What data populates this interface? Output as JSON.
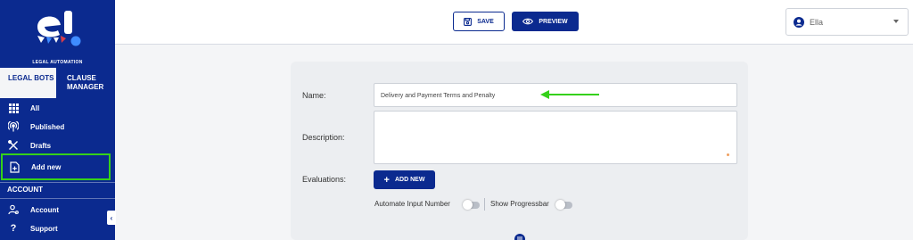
{
  "brand": {
    "caption": "LEGAL AUTOMATION",
    "logo_icon": "elegal-logo-icon",
    "accent_color": "#0b2a8f"
  },
  "sidebar": {
    "tabs": [
      {
        "label": "LEGAL BOTS",
        "active": true
      },
      {
        "label": "CLAUSE MANAGER",
        "active": false
      }
    ],
    "items": [
      {
        "label": "All",
        "icon": "grid-icon"
      },
      {
        "label": "Published",
        "icon": "broadcast-icon"
      },
      {
        "label": "Drafts",
        "icon": "tools-icon"
      },
      {
        "label": "Add new",
        "icon": "file-plus-icon",
        "highlighted": true
      }
    ],
    "account_section": {
      "title": "ACCOUNT",
      "items": [
        {
          "label": "Account",
          "icon": "user-settings-icon"
        },
        {
          "label": "Support",
          "icon": "question-icon"
        }
      ]
    },
    "collapse_label": "‹"
  },
  "toolbar": {
    "save_label": "SAVE",
    "preview_label": "PREVIEW"
  },
  "user": {
    "name": "Ella"
  },
  "form": {
    "name_label": "Name:",
    "name_value": "Delivery and Payment Terms and Penalty",
    "description_label": "Description:",
    "description_value": "",
    "evaluations_label": "Evaluations:",
    "add_new_label": "ADD NEW",
    "automate_input_label": "Automate Input Number",
    "automate_input_on": false,
    "show_progressbar_label": "Show Progressbar",
    "show_progressbar_on": false
  },
  "annotation": {
    "arrow_color": "#35d119",
    "highlight_color": "#35d119"
  }
}
